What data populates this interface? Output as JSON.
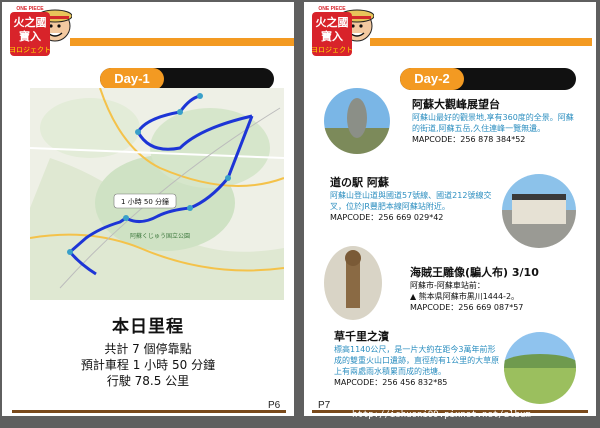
{
  "logo": {
    "line1": "火之國",
    "line2": "寶入",
    "line3": "ヨロジェクト",
    "badge": "ONE PIECE"
  },
  "left_page": {
    "day_label": "Day-1",
    "map": {
      "route_time": "1 小時 50 分鐘",
      "park_label": "阿蘇くじゅう国立公園"
    },
    "summary": {
      "title": "本日里程",
      "stops": "共計 7 個停靠點",
      "drive_time": "預計車程 1 小時 50 分鐘",
      "distance": "行駛 78.5 公里"
    },
    "page_number": "P6"
  },
  "right_page": {
    "day_label": "Day-2",
    "spots": [
      {
        "title": "阿蘇大觀峰展望台",
        "desc": "阿蘇山最好的觀景地,享有360度的全景。阿蘇的街道,阿蘇五岳,久住連峰一覽無遺。",
        "mapcode": "MAPCODE：256 878 384*52"
      },
      {
        "title": "道の駅 阿蘇",
        "desc": "阿蘇山登山道與國道57號線、國道212號線交叉，位於JR豐肥本線阿蘇站附近。",
        "mapcode": "MAPCODE：256 669 029*42"
      },
      {
        "title": "海賊王雕像(騙人布) 3/10",
        "desc_line1": "阿蘇市-阿蘇車站前：",
        "desc_line2": "▲ 熊本県阿蘇市黒川1444-2。",
        "mapcode": "MAPCODE：256 669 087*57"
      },
      {
        "title": "草千里之濱",
        "desc": "標高1140公尺，是一片大約在距今3萬年前形成的雙重火山口遺跡，直徑約有1公里的大草原上有兩處雨水積累而成的池塘。",
        "mapcode": "MAPCODE：256 456 832*85"
      }
    ],
    "page_number": "P7"
  },
  "watermark": "http://ishuoni99.pixnet.net/album",
  "colors": {
    "accent": "#f39a22",
    "route": "#1d35d6",
    "desc_text": "#2d8fc0",
    "footer_line": "#7a4a1c"
  }
}
